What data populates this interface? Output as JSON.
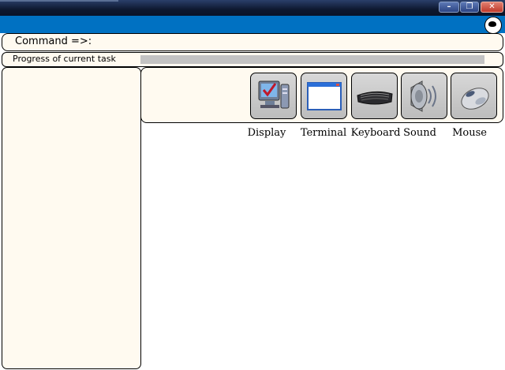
{
  "window": {
    "controls": [
      "minimize-icon",
      "restore-icon",
      "close-icon"
    ]
  },
  "command_bar": {
    "label": "Command =>:"
  },
  "progress": {
    "label": "Progress of current task",
    "value": 0
  },
  "toolbar": {
    "items": [
      {
        "label": "Display",
        "icon": "display-icon"
      },
      {
        "label": "Terminal",
        "icon": "terminal-icon"
      },
      {
        "label": "Keyboard",
        "icon": "keyboard-icon"
      },
      {
        "label": "Sound",
        "icon": "sound-icon"
      },
      {
        "label": "Mouse",
        "icon": "mouse-icon"
      }
    ]
  },
  "colors": {
    "accent_bar": "#0071c2",
    "panel_bg": "#fffaf0",
    "progress_track": "#c3c3c3"
  }
}
